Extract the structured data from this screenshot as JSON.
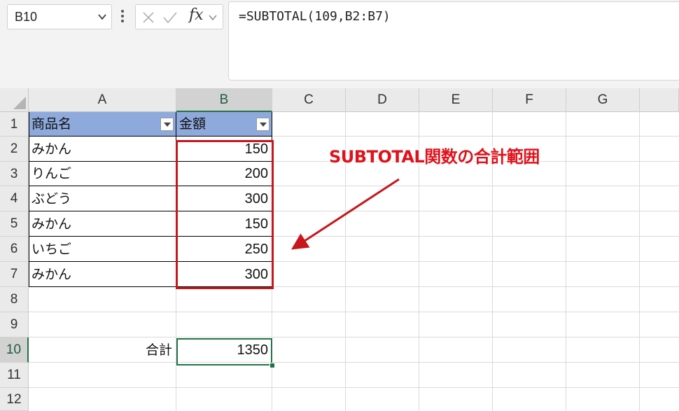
{
  "formula_bar": {
    "name_box": "B10",
    "fx_label": "fx",
    "formula": "=SUBTOTAL(109,B2:B7)"
  },
  "columns": [
    "A",
    "B",
    "C",
    "D",
    "E",
    "F",
    "G"
  ],
  "rows": [
    "1",
    "2",
    "3",
    "4",
    "5",
    "6",
    "7",
    "8",
    "9",
    "10",
    "11",
    "12"
  ],
  "table": {
    "headers": [
      "商品名",
      "金額"
    ],
    "items": [
      {
        "name": "みかん",
        "price": "150"
      },
      {
        "name": "りんご",
        "price": "200"
      },
      {
        "name": "ぶどう",
        "price": "300"
      },
      {
        "name": "みかん",
        "price": "150"
      },
      {
        "name": "いちご",
        "price": "250"
      },
      {
        "name": "みかん",
        "price": "300"
      }
    ]
  },
  "total": {
    "label": "合計",
    "value": "1350"
  },
  "annotation": "SUBTOTAL関数の合計範囲",
  "colors": {
    "header_fill": "#8ea9db",
    "highlight": "#c8161d",
    "excel_green": "#217346"
  }
}
